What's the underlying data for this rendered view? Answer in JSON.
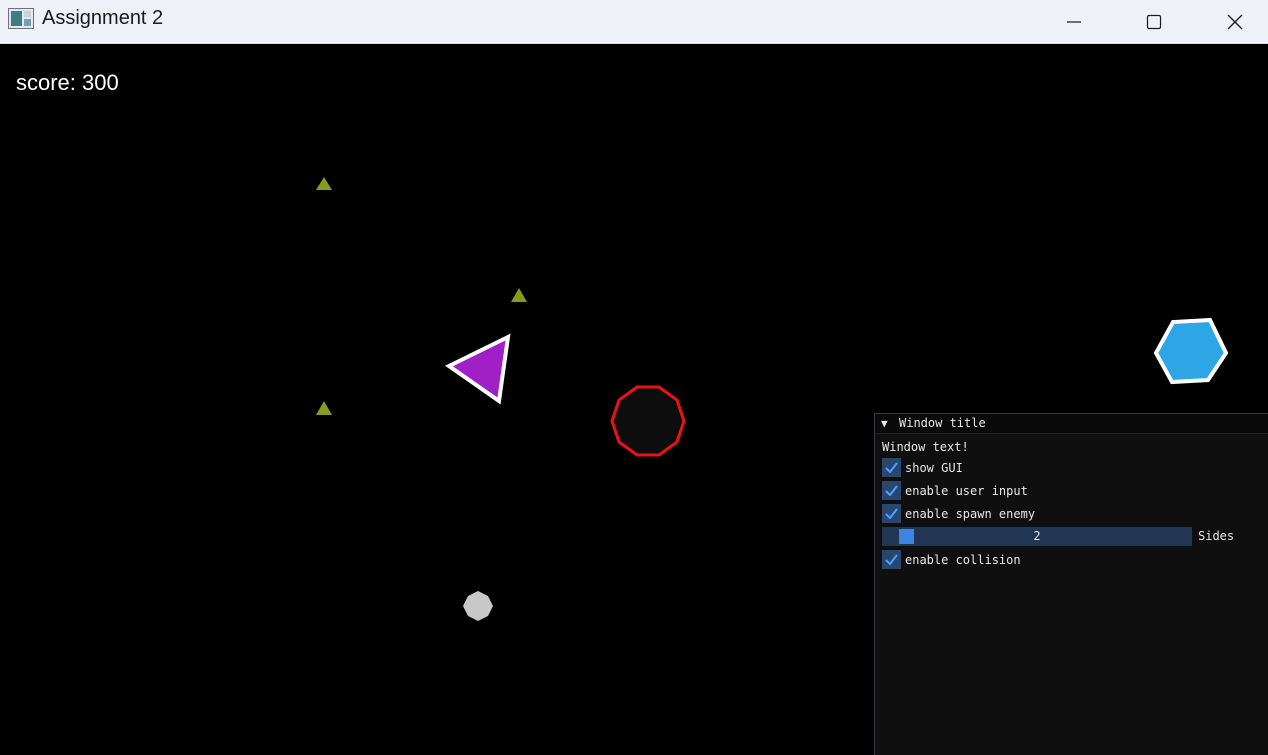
{
  "window": {
    "title": "Assignment 2"
  },
  "game": {
    "score_text": "score: 300"
  },
  "imgui": {
    "title": "Window title",
    "text": "Window text!",
    "checkboxes": [
      {
        "label": "show GUI",
        "checked": true
      },
      {
        "label": "enable user input",
        "checked": true
      },
      {
        "label": "enable spawn enemy",
        "checked": true
      },
      {
        "label": "enable collision",
        "checked": true
      }
    ],
    "slider": {
      "value": "2",
      "label": "Sides"
    }
  },
  "colors": {
    "background": "#000000",
    "player_fill": "#a020c8",
    "player_outline": "#ffffff",
    "enemy_outline_red": "#ee1111",
    "enemy_blue": "#2ea6e6",
    "small_triangles": "#8a9a1a",
    "grey_shape": "#c8c8c8",
    "checkbox_bg": "#29466f",
    "slider_bg": "#213652",
    "slider_grab": "#3d85e0"
  }
}
